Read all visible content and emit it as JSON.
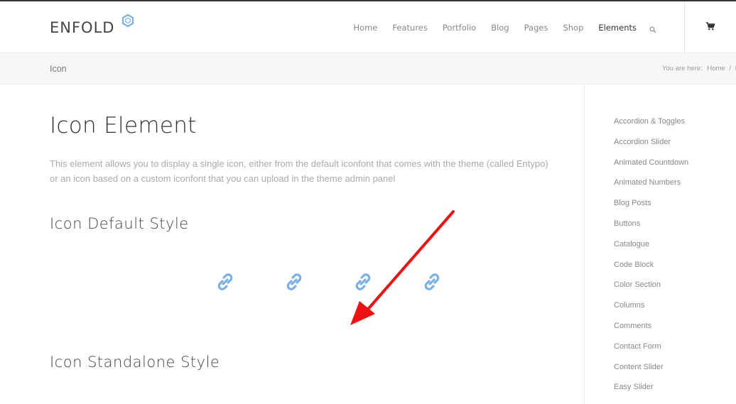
{
  "brand": {
    "name": "ENFOLD",
    "accent": "#7bb0e7"
  },
  "nav": {
    "items": [
      {
        "label": "Home",
        "active": false
      },
      {
        "label": "Features",
        "active": false
      },
      {
        "label": "Portfolio",
        "active": false
      },
      {
        "label": "Blog",
        "active": false
      },
      {
        "label": "Pages",
        "active": false
      },
      {
        "label": "Shop",
        "active": false
      },
      {
        "label": "Elements",
        "active": true
      }
    ],
    "search_icon": "search-icon",
    "cart_icon": "cart-icon"
  },
  "title_bar": {
    "title": "Icon",
    "breadcrumb": {
      "prefix": "You are here:",
      "home": "Home",
      "separator": "/",
      "current": "E"
    }
  },
  "content": {
    "title": "Icon Element",
    "description": "This element allows you to display a single icon, either from the default iconfont that comes with the theme (called Entypo) or an icon based on a custom iconfont that you can upload in the theme admin panel",
    "section1_title": "Icon Default Style",
    "section2_title": "Icon Standalone Style",
    "icons": [
      "link-icon",
      "link-icon",
      "link-icon",
      "link-icon"
    ],
    "icon_color": "#7bb0e7",
    "annotation_color": "#ee1111"
  },
  "sidebar": {
    "items": [
      "Accordion & Toggles",
      "Accordion Slider",
      "Animated Countdown",
      "Animated Numbers",
      "Blog Posts",
      "Buttons",
      "Catalogue",
      "Code Block",
      "Color Section",
      "Columns",
      "Comments",
      "Contact Form",
      "Content Slider",
      "Easy Slider"
    ]
  }
}
